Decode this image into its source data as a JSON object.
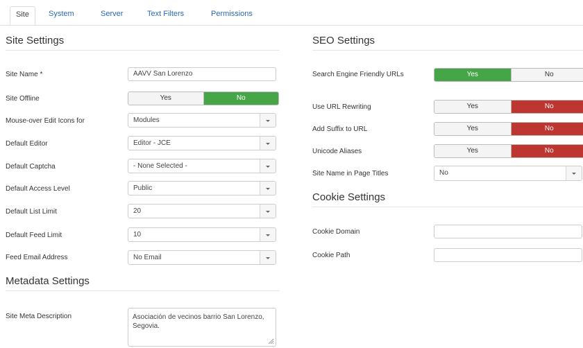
{
  "tabs": [
    {
      "label": "Site",
      "active": true
    },
    {
      "label": "System"
    },
    {
      "label": "Server"
    },
    {
      "label": "Text Filters"
    },
    {
      "label": "Permissions"
    }
  ],
  "site_settings": {
    "title": "Site Settings",
    "site_name": {
      "label": "Site Name *",
      "value": "AAVV San Lorenzo"
    },
    "site_offline": {
      "label": "Site Offline",
      "yes": "Yes",
      "no": "No",
      "selected": "No"
    },
    "mouseover": {
      "label": "Mouse-over Edit Icons for",
      "value": "Modules"
    },
    "default_editor": {
      "label": "Default Editor",
      "value": "Editor - JCE"
    },
    "default_captcha": {
      "label": "Default Captcha",
      "value": "- None Selected -"
    },
    "default_access": {
      "label": "Default Access Level",
      "value": "Public"
    },
    "list_limit": {
      "label": "Default List Limit",
      "value": "20"
    },
    "feed_limit": {
      "label": "Default Feed Limit",
      "value": "10"
    },
    "feed_email": {
      "label": "Feed Email Address",
      "value": "No Email"
    }
  },
  "metadata_settings": {
    "title": "Metadata Settings",
    "meta_description": {
      "label": "Site Meta Description",
      "value": "Asociación de vecinos barrio San Lorenzo, Segovia."
    }
  },
  "seo_settings": {
    "title": "SEO Settings",
    "sef_urls": {
      "label": "Search Engine Friendly URLs",
      "yes": "Yes",
      "no": "No",
      "selected": "Yes"
    },
    "url_rewriting": {
      "label": "Use URL Rewriting",
      "yes": "Yes",
      "no": "No",
      "selected": "No"
    },
    "add_suffix": {
      "label": "Add Suffix to URL",
      "yes": "Yes",
      "no": "No",
      "selected": "No"
    },
    "unicode_aliases": {
      "label": "Unicode Aliases",
      "yes": "Yes",
      "no": "No",
      "selected": "No"
    },
    "site_name_titles": {
      "label": "Site Name in Page Titles",
      "value": "No"
    }
  },
  "cookie_settings": {
    "title": "Cookie Settings",
    "cookie_domain": {
      "label": "Cookie Domain",
      "value": ""
    },
    "cookie_path": {
      "label": "Cookie Path",
      "value": ""
    }
  },
  "colors": {
    "yes_active": "#46a546",
    "no_active": "#bd362f",
    "link": "#2a69b8"
  }
}
